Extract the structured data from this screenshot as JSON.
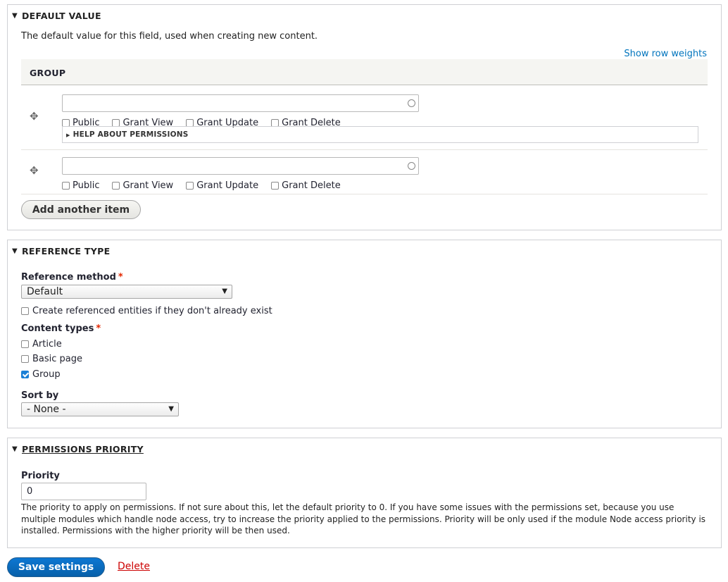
{
  "default_value": {
    "legend": "DEFAULT VALUE",
    "description": "The default value for this field, used when creating new content.",
    "show_row_weights": "Show row weights",
    "table_header": "GROUP",
    "rows": [
      {
        "value": "",
        "options": [
          "Public",
          "Grant View",
          "Grant Update",
          "Grant Delete"
        ],
        "help": "HELP ABOUT PERMISSIONS"
      },
      {
        "value": "",
        "options": [
          "Public",
          "Grant View",
          "Grant Update",
          "Grant Delete"
        ]
      }
    ],
    "add_button": "Add another item"
  },
  "reference_type": {
    "legend": "REFERENCE TYPE",
    "method_label": "Reference method",
    "method_value": "Default",
    "create_label": "Create referenced entities if they don't already exist",
    "content_types_label": "Content types",
    "content_types": [
      {
        "label": "Article",
        "checked": false
      },
      {
        "label": "Basic page",
        "checked": false
      },
      {
        "label": "Group",
        "checked": true
      }
    ],
    "sort_label": "Sort by",
    "sort_value": "- None -"
  },
  "permissions_priority": {
    "legend": "PERMISSIONS PRIORITY",
    "priority_label": "Priority",
    "priority_value": "0",
    "description": "The priority to apply on permissions. If not sure about this, let the default priority to 0. If you have some issues with the permissions set, because you use multiple modules which handle node access, try to increase the priority applied to the permissions. Priority will be only used if the module Node access priority is installed. Permissions with the higher priority will be then used."
  },
  "required_marker": "*",
  "actions": {
    "save": "Save settings",
    "delete": "Delete"
  },
  "colors": {
    "link": "#0074bd",
    "primary": "#0760a9",
    "danger": "#cc0000",
    "required": "#e32700"
  }
}
